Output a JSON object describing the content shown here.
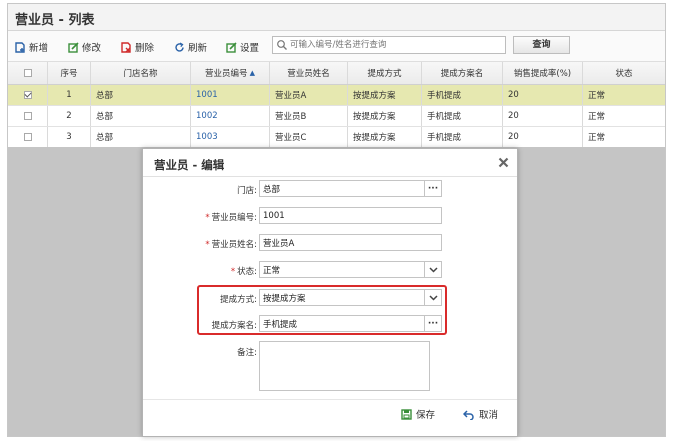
{
  "page": {
    "title": "营业员 - 列表"
  },
  "toolbar": {
    "add_label": "新增",
    "edit_label": "修改",
    "delete_label": "删除",
    "refresh_label": "刷新",
    "settings_label": "设置",
    "search_placeholder": "可输入编号/姓名进行查询",
    "query_label": "查询"
  },
  "grid": {
    "headers": [
      "序号",
      "门店名称",
      "营业员编号",
      "营业员姓名",
      "提成方式",
      "提成方案名",
      "销售提成率(%)",
      "状态"
    ],
    "sort_indicator": "▲",
    "rows": [
      {
        "checked": true,
        "index": "1",
        "store": "总部",
        "code": "1001",
        "name": "营业员A",
        "method": "按提成方案",
        "plan": "手机提成",
        "rate": "20",
        "status": "正常"
      },
      {
        "checked": false,
        "index": "2",
        "store": "总部",
        "code": "1002",
        "name": "营业员B",
        "method": "按提成方案",
        "plan": "手机提成",
        "rate": "20",
        "status": "正常"
      },
      {
        "checked": false,
        "index": "3",
        "store": "总部",
        "code": "1003",
        "name": "营业员C",
        "method": "按提成方案",
        "plan": "手机提成",
        "rate": "20",
        "status": "正常"
      }
    ]
  },
  "modal": {
    "title": "营业员 - 编辑",
    "fields": {
      "store_label": "门店:",
      "store_value": "总部",
      "code_label": "营业员编号:",
      "code_value": "1001",
      "name_label": "营业员姓名:",
      "name_value": "营业员A",
      "status_label": "状态:",
      "status_value": "正常",
      "method_label": "提成方式:",
      "method_value": "按提成方案",
      "plan_label": "提成方案名:",
      "plan_value": "手机提成",
      "remark_label": "备注:"
    },
    "required_mark": "*",
    "save_label": "保存",
    "cancel_label": "取消"
  },
  "colors": {
    "accent_blue": "#2a62a8",
    "selected_row": "#e6e8b0",
    "required_red": "#d02a2a",
    "highlight_red": "#d92b2b",
    "save_green": "#3a8f3a"
  }
}
